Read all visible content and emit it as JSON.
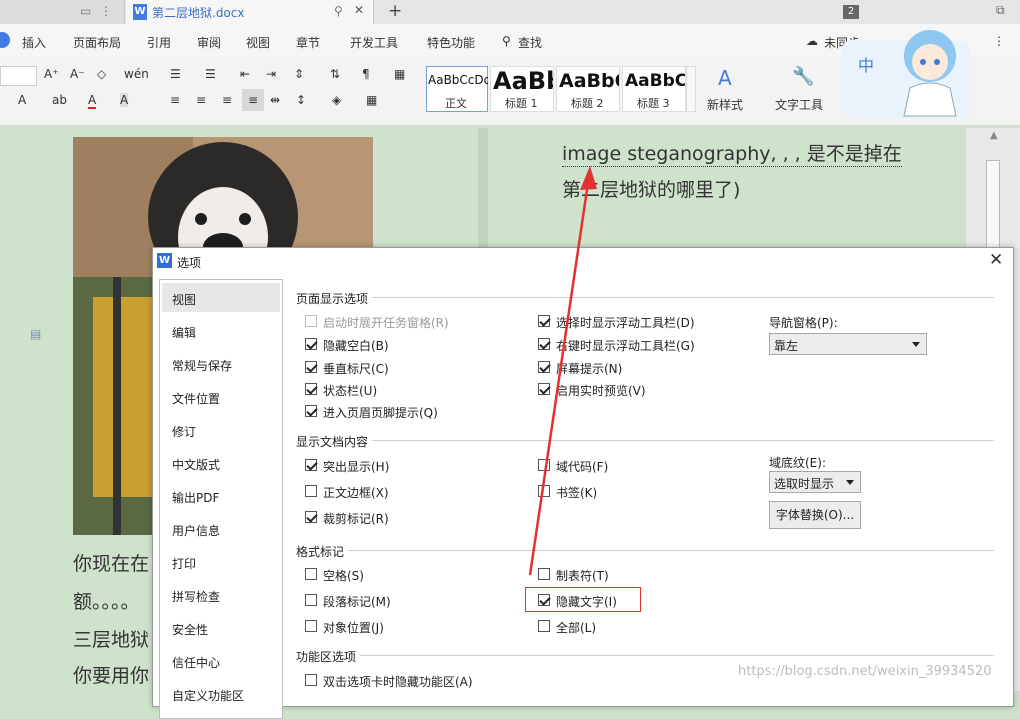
{
  "tabs": {
    "active_title": "第二层地狱.docx",
    "doc_icon": "W",
    "new_tab": "+",
    "page_badge": "2"
  },
  "menu": {
    "items": [
      "插入",
      "页面布局",
      "引用",
      "审阅",
      "视图",
      "章节",
      "开发工具",
      "特色功能"
    ],
    "search": "查找",
    "cloud": "未同步"
  },
  "ribbon": {
    "styles": [
      {
        "sample": "AaBbCcDd",
        "name": "正文"
      },
      {
        "sample": "AaBb",
        "name": "标题 1"
      },
      {
        "sample": "AaBbC",
        "name": "标题 2"
      },
      {
        "sample": "AaBbC",
        "name": "标题 3"
      }
    ],
    "new_style": "新样式",
    "text_tools": "文字工具",
    "mascot_label": "中"
  },
  "document": {
    "right_line1": "image steganography, , , 是不是掉在",
    "right_line2": "第二层地狱的哪里了)",
    "left_lines": [
      "你现在在",
      "额。。。。",
      "三层地狱",
      "你要用你"
    ]
  },
  "dialog": {
    "title": "选项",
    "icon": "W",
    "close": "✕",
    "sidebar": [
      "视图",
      "编辑",
      "常规与保存",
      "文件位置",
      "修订",
      "中文版式",
      "输出PDF",
      "用户信息",
      "打印",
      "拼写检查",
      "安全性",
      "信任中心",
      "自定义功能区"
    ],
    "section_page_display": "页面显示选项",
    "page_opts_left": [
      {
        "label": "启动时展开任务窗格(R)",
        "checked": false,
        "disabled": true
      },
      {
        "label": "隐藏空白(B)",
        "checked": true
      },
      {
        "label": "垂直标尺(C)",
        "checked": true
      },
      {
        "label": "状态栏(U)",
        "checked": true
      },
      {
        "label": "进入页眉页脚提示(Q)",
        "checked": true
      }
    ],
    "page_opts_mid": [
      {
        "label": "选择时显示浮动工具栏(D)",
        "checked": true
      },
      {
        "label": "右键时显示浮动工具栏(G)",
        "checked": true
      },
      {
        "label": "屏幕提示(N)",
        "checked": true
      },
      {
        "label": "启用实时预览(V)",
        "checked": true
      }
    ],
    "nav_pane_label": "导航窗格(P):",
    "nav_pane_value": "靠左",
    "section_doc_content": "显示文档内容",
    "doc_opts_left": [
      {
        "label": "突出显示(H)",
        "checked": true
      },
      {
        "label": "正文边框(X)",
        "checked": false
      },
      {
        "label": "裁剪标记(R)",
        "checked": true
      }
    ],
    "doc_opts_mid": [
      {
        "label": "域代码(F)",
        "checked": false
      },
      {
        "label": "书签(K)",
        "checked": false
      }
    ],
    "field_shading_label": "域底纹(E):",
    "field_shading_value": "选取时显示",
    "font_sub_button": "字体替换(O)...",
    "section_format_marks": "格式标记",
    "fmt_left": [
      {
        "label": "空格(S)",
        "checked": false
      },
      {
        "label": "段落标记(M)",
        "checked": false
      },
      {
        "label": "对象位置(J)",
        "checked": false
      }
    ],
    "fmt_mid": [
      {
        "label": "制表符(T)",
        "checked": false
      },
      {
        "label": "隐藏文字(I)",
        "checked": true
      },
      {
        "label": "全部(L)",
        "checked": false
      }
    ],
    "section_ribbon": "功能区选项",
    "ribbon_opt": {
      "label": "双击选项卡时隐藏功能区(A)",
      "checked": false
    }
  },
  "watermark": "https://blog.csdn.net/weixin_39934520"
}
